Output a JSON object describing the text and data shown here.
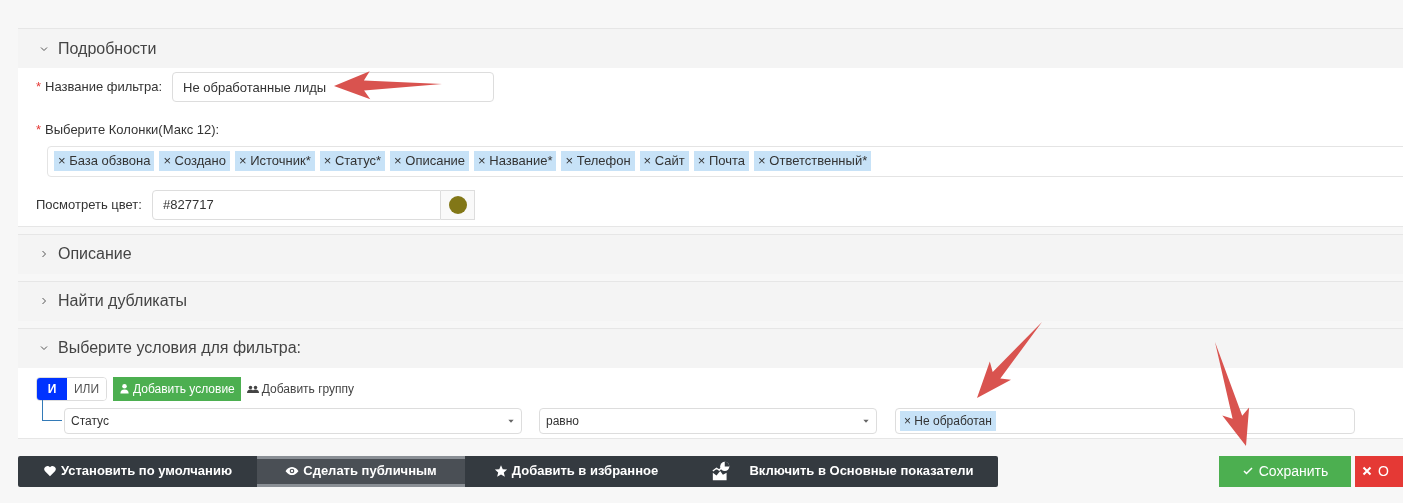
{
  "sections": [
    {
      "title": "Подробности",
      "expanded": true,
      "details": {
        "required_mark": "*",
        "name_label": "Название фильтра:",
        "name_value": "Не обработанные лиды",
        "columns_label": "Выберите Колонки(Макс 12):",
        "columns": [
          "× База обзвона",
          "× Создано",
          "× Источник*",
          "× Статус*",
          "× Описание",
          "× Название*",
          "× Телефон",
          "× Сайт",
          "× Почта",
          "× Ответственный*"
        ],
        "color_label": "Посмотреть цвет:",
        "color_value": "#827717",
        "color": "#827717"
      }
    },
    {
      "title": "Описание",
      "expanded": false
    },
    {
      "title": "Найти дубликаты",
      "expanded": false
    },
    {
      "title": "Выберите условия для фильтра:",
      "expanded": true,
      "conditions": {
        "logic": [
          {
            "label": "И",
            "selected": true
          },
          {
            "label": "ИЛИ",
            "selected": false
          }
        ],
        "add_condition": "Добавить условие",
        "add_group": "Добавить группу",
        "rows": [
          {
            "field": "Статус",
            "operator": "равно",
            "values": [
              "× Не обработан"
            ]
          }
        ]
      }
    }
  ],
  "toolbar": [
    {
      "label": "Установить по умолчанию",
      "selected": false
    },
    {
      "label": "Сделать публичным",
      "selected": true
    },
    {
      "label": "Добавить в избранное",
      "selected": false
    },
    {
      "label": "Включить в Основные показатели",
      "selected": false
    }
  ],
  "actions": [
    {
      "kind": "save",
      "label": "Сохранить"
    },
    {
      "kind": "cancel",
      "label": "О"
    }
  ]
}
